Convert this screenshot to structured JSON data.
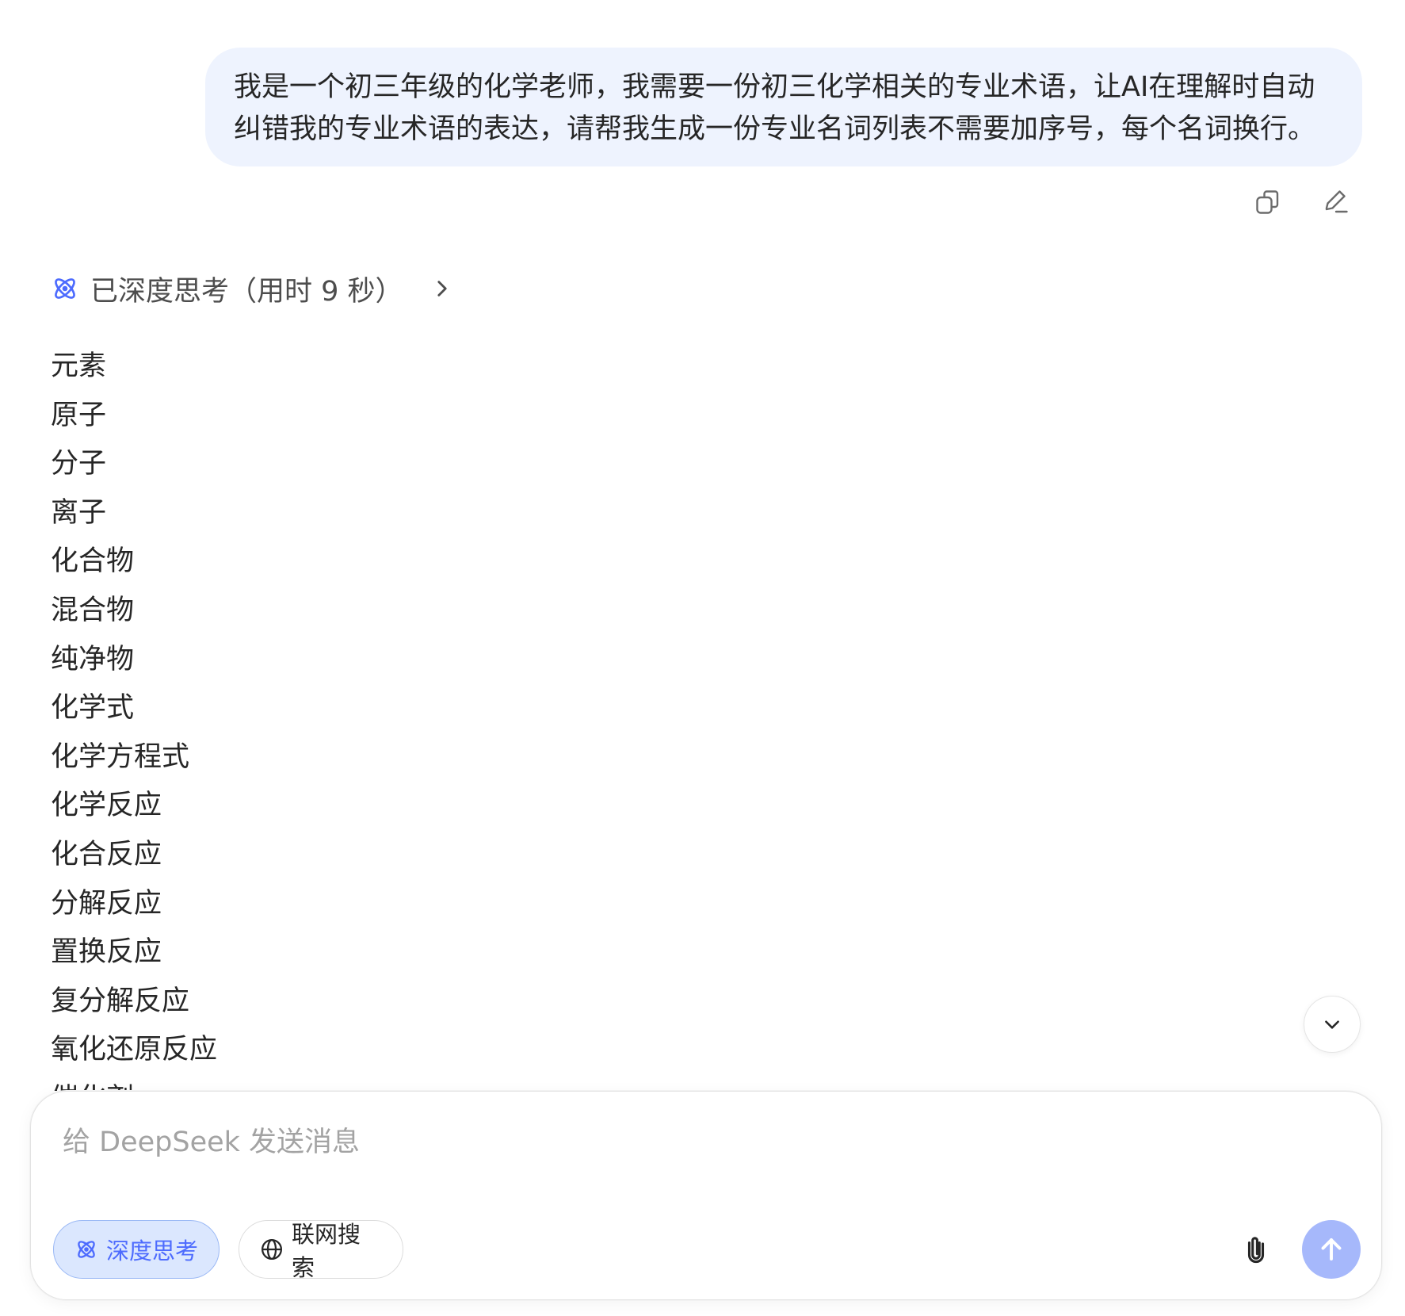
{
  "user_message": {
    "text": "我是一个初三年级的化学老师，我需要一份初三化学相关的专业术语，让AI在理解时自动纠错我的专业术语的表达，请帮我生成一份专业名词列表不需要加序号，每个名词换行。"
  },
  "thought": {
    "label": "已深度思考（用时 9 秒）"
  },
  "answer": {
    "terms": [
      "元素",
      "原子",
      "分子",
      "离子",
      "化合物",
      "混合物",
      "纯净物",
      "化学式",
      "化学方程式",
      "化学反应",
      "化合反应",
      "分解反应",
      "置换反应",
      "复分解反应",
      "氧化还原反应",
      "催化剂"
    ]
  },
  "composer": {
    "placeholder": "给 DeepSeek 发送消息",
    "deep_think_label": "深度思考",
    "web_search_label": "联网搜索"
  },
  "colors": {
    "accent": "#4d6bfe",
    "bubble_bg": "#eef3fe",
    "chip_active_bg": "#dbe7fe",
    "send_button": "#a6b8fb"
  },
  "icons": [
    "copy-icon",
    "edit-icon",
    "deep-think-icon",
    "chevron-right-icon",
    "chevron-down-icon",
    "globe-icon",
    "paperclip-icon",
    "arrow-up-icon"
  ]
}
